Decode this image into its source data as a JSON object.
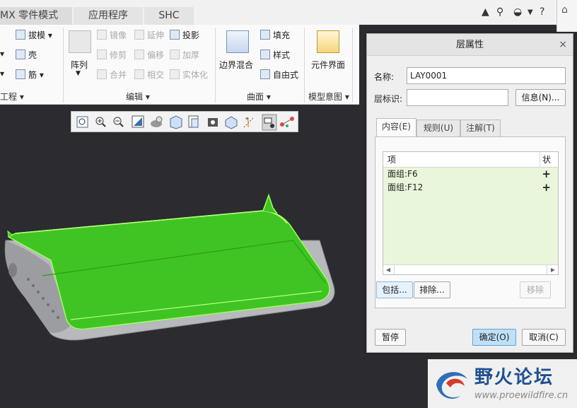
{
  "tabs": [
    {
      "label": "MX 零件模式"
    },
    {
      "label": "应用程序"
    },
    {
      "label": "SHC"
    }
  ],
  "ribbon": {
    "engineering": {
      "items": [
        "拔模",
        "壳",
        "筋"
      ],
      "group_label": "工程"
    },
    "editing": {
      "pattern_label": "阵列",
      "items": [
        "镜像",
        "延伸",
        "投影",
        "修剪",
        "偏移",
        "加厚",
        "合并",
        "相交",
        "实体化"
      ],
      "group_label": "编辑"
    },
    "surfaces": {
      "boundary_blend_label": "边界混合",
      "items": [
        "填充",
        "样式",
        "自由式"
      ],
      "group_label": "曲面"
    },
    "model_intent": {
      "component_interface_label": "元件界面",
      "group_label": "模型意图"
    }
  },
  "graphics_toolbar": {
    "icons": [
      "refit-icon",
      "zoom-in-icon",
      "zoom-out-icon",
      "repaint-icon",
      "display-style-icon",
      "saved-views-icon",
      "view-manager-icon",
      "perspective-icon",
      "spin-center-icon",
      "datum-display-icon",
      "annotation-display-icon",
      "simulation-display-icon"
    ]
  },
  "dialog": {
    "title": "层属性",
    "name_label": "名称:",
    "name_value": "LAY0001",
    "layer_id_label": "层标识:",
    "layer_id_value": "",
    "info_button": "信息(N)...",
    "tabs": [
      {
        "label": "内容(E)"
      },
      {
        "label": "规则(U)"
      },
      {
        "label": "注解(T)"
      }
    ],
    "list": {
      "col_item": "项",
      "col_status": "状",
      "rows": [
        {
          "item": "面组:F6",
          "status": "+"
        },
        {
          "item": "面组:F12",
          "status": "+"
        }
      ]
    },
    "include_button": "包括...",
    "exclude_button": "排除...",
    "remove_button": "移除",
    "pause_button": "暂停",
    "ok_button": "确定(O)",
    "cancel_button": "取消(C)"
  },
  "watermark": {
    "title": "野火论坛",
    "url": "www.proewildfire.cn"
  },
  "colors": {
    "highlight_green": "#3fc423",
    "model_gray": "#b7b9bd",
    "background": "#2b2b30",
    "primary_button": "#bfe0f7"
  }
}
